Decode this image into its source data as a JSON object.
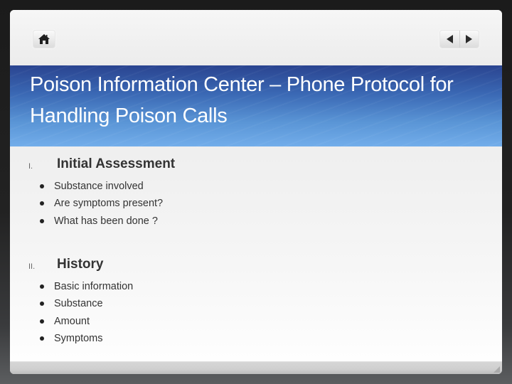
{
  "toolbar": {
    "home_icon": "home-icon",
    "prev_icon": "triangle-left-icon",
    "next_icon": "triangle-right-icon"
  },
  "slide": {
    "title": "Poison Information Center – Phone Protocol for Handling Poison Calls",
    "sections": [
      {
        "numeral": "I.",
        "heading": "Initial  Assessment",
        "bullets": [
          "Substance involved",
          "Are symptoms present?",
          "What has been done ?"
        ]
      },
      {
        "numeral": "II.",
        "heading": "History",
        "bullets": [
          "Basic information",
          "Substance",
          "Amount",
          "Symptoms"
        ]
      }
    ]
  },
  "colors": {
    "title_band_top": "#2a4490",
    "title_band_bottom": "#72adea",
    "title_text": "#ffffff",
    "body_text": "#333333"
  }
}
